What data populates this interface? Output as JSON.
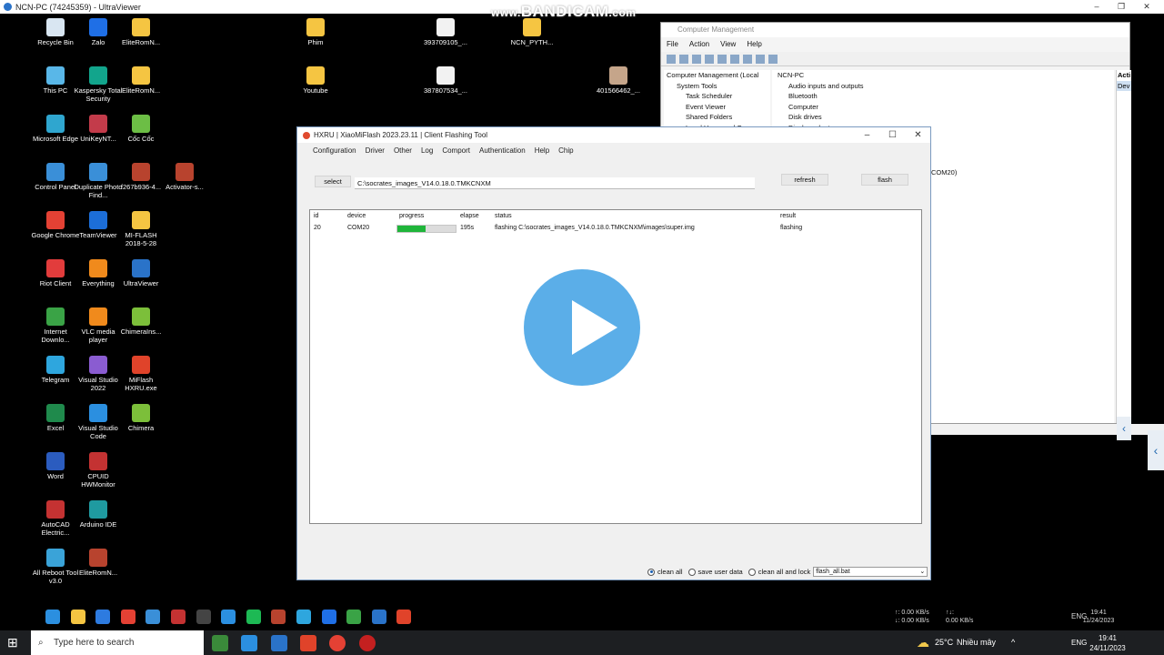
{
  "window": {
    "title": "NCN-PC (74245359) - UltraViewer",
    "min": "–",
    "max": "❐",
    "close": "✕"
  },
  "watermark": {
    "prefix": "www.",
    "brand": "BANDICAM",
    "suffix": ".com"
  },
  "desktop_icons": [
    {
      "label": "Recycle Bin",
      "color": "#d9e6f2"
    },
    {
      "label": "Zalo",
      "color": "#1f6fe6"
    },
    {
      "label": "EliteRomN...",
      "color": "#f5c542"
    },
    {
      "label": "This PC",
      "color": "#59b7e8"
    },
    {
      "label": "Kaspersky Total Security",
      "color": "#12a58c"
    },
    {
      "label": "EliteRomN...",
      "color": "#f5c542"
    },
    {
      "label": "Microsoft Edge",
      "color": "#2fa6cf"
    },
    {
      "label": "UniKeyNT...",
      "color": "#c33b4a"
    },
    {
      "label": "Cốc Cốc",
      "color": "#6cbe45"
    },
    {
      "label": "Control Panel",
      "color": "#3a8fd8"
    },
    {
      "label": "Duplicate Photo Find...",
      "color": "#3a8fd8"
    },
    {
      "label": "f267b936-4...",
      "color": "#b8432e"
    },
    {
      "label": "Activator-s...",
      "color": "#b8432e"
    },
    {
      "label": "Google Chrome",
      "color": "#e44134"
    },
    {
      "label": "TeamViewer",
      "color": "#1c6ed8"
    },
    {
      "label": "MI-FLASH 2018-5-28",
      "color": "#f5c542"
    },
    {
      "label": "Riot Client",
      "color": "#e23c3c"
    },
    {
      "label": "Everything",
      "color": "#f08a1c"
    },
    {
      "label": "UltraViewer",
      "color": "#2a73c9"
    },
    {
      "label": "Internet Downlo...",
      "color": "#3aa346"
    },
    {
      "label": "VLC media player",
      "color": "#f08a1c"
    },
    {
      "label": "ChimeraIns...",
      "color": "#7cbf3a"
    },
    {
      "label": "Telegram",
      "color": "#2ea6de"
    },
    {
      "label": "Visual Studio 2022",
      "color": "#8a5cd1"
    },
    {
      "label": "MiFlash HXRU.exe",
      "color": "#e0432a"
    },
    {
      "label": "Excel",
      "color": "#1f8a4c"
    },
    {
      "label": "Visual Studio Code",
      "color": "#2b8fe0"
    },
    {
      "label": "Chimera",
      "color": "#7cbf3a"
    },
    {
      "label": "Word",
      "color": "#2b5cbf"
    },
    {
      "label": "CPUID HWMonitor",
      "color": "#c43232"
    },
    {
      "label": "AutoCAD Electric...",
      "color": "#c43232"
    },
    {
      "label": "Arduino IDE",
      "color": "#1f9aa0"
    },
    {
      "label": "All Reboot Tool v3.0",
      "color": "#3aa3d8"
    },
    {
      "label": "EliteRomN...",
      "color": "#b8432e"
    },
    {
      "label": "Phim",
      "color": "#f5c542"
    },
    {
      "label": "Youtube",
      "color": "#f5c542"
    },
    {
      "label": "393709105_...",
      "color": "#f2f2f2"
    },
    {
      "label": "387807534_...",
      "color": "#f2f2f2"
    },
    {
      "label": "NCN_PYTH...",
      "color": "#f5c542"
    },
    {
      "label": "401566462_...",
      "color": "#c5a58a"
    }
  ],
  "computer_management": {
    "title": "Computer Management",
    "menu": [
      "File",
      "Action",
      "View",
      "Help"
    ],
    "tree": [
      "Computer Management (Local",
      "System Tools",
      "Task Scheduler",
      "Event Viewer",
      "Shared Folders",
      "Local Users and Groups"
    ],
    "devices": [
      "NCN-PC",
      "Audio inputs and outputs",
      "Bluetooth",
      "Computer",
      "Disk drives",
      "Display adapters"
    ],
    "actions_header": "Acti",
    "actions_item": "Dev",
    "port_fragment": "COM20)"
  },
  "flash_tool": {
    "title": "HXRU | XiaoMiFlash 2023.23.11 | Client Flashing Tool",
    "menu": [
      "Configuration",
      "Driver",
      "Other",
      "Log",
      "Comport",
      "Authentication",
      "Help",
      "Chip"
    ],
    "select_button": "select",
    "path": "C:\\socrates_images_V14.0.18.0.TMKCNXM",
    "refresh_button": "refresh",
    "flash_button": "flash",
    "columns": {
      "id": "id",
      "device": "device",
      "progress": "progress",
      "elapse": "elapse",
      "status": "status",
      "result": "result"
    },
    "rows": [
      {
        "id": "20",
        "device": "COM20",
        "progress": 0.48,
        "elapse": "195s",
        "status": "flashing C:\\socrates_images_V14.0.18.0.TMKCNXM\\images\\super.img",
        "result": "flashing"
      }
    ],
    "options": {
      "clean_all": "clean all",
      "save_user_data": "save user data",
      "clean_all_lock": "clean all and lock",
      "selected": "clean_all",
      "script": "flash_all.bat"
    }
  },
  "inner_tray": {
    "up": "↑: 0.00 KB/s",
    "down": "↓: 0.00 KB/s",
    "up2": "↑↓:",
    "down2": "0.00 KB/s",
    "lang": "ENG",
    "time": "19:41",
    "date": "11/24/2023"
  },
  "taskbar": {
    "search_placeholder": "Type here to search",
    "weather_temp": "25°C",
    "weather_desc": "Nhiều mây",
    "lang": "ENG",
    "time": "19:41",
    "date": "24/11/2023"
  },
  "colors": {
    "progress_fill": "#1fb53a",
    "play_button": "#4aa6e6"
  }
}
